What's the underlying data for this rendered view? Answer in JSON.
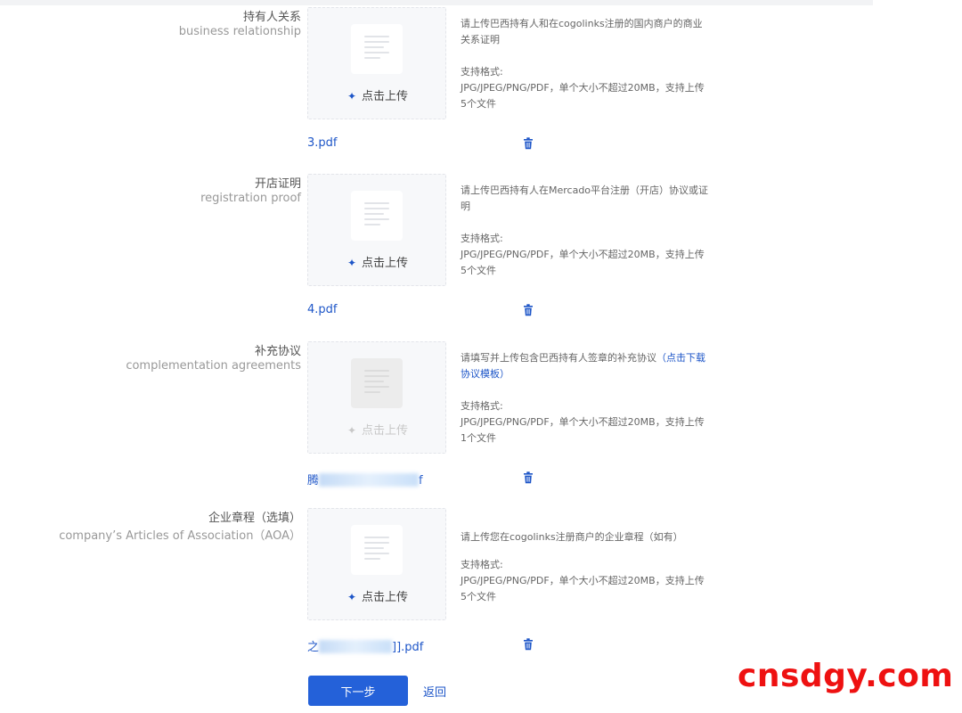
{
  "form": {
    "fields": [
      {
        "label_cn": "持有人关系",
        "label_en": "business relationship",
        "upload_label": "点击上传",
        "desc": "请上传巴西持有人和在cogolinks注册的国内商户的商业关系证明",
        "desc_link": "",
        "format_title": "支持格式:",
        "format_text": "JPG/JPEG/PNG/PDF，单个大小不超过20MB，支持上传5个文件",
        "file": {
          "prefix": "3.pdf",
          "suffix": ""
        }
      },
      {
        "label_cn": "开店证明",
        "label_en": "registration proof",
        "upload_label": "点击上传",
        "desc": "请上传巴西持有人在Mercado平台注册（开店）协议或证明",
        "desc_link": "",
        "format_title": "支持格式:",
        "format_text": "JPG/JPEG/PNG/PDF，单个大小不超过20MB，支持上传5个文件",
        "file": {
          "prefix": "4.pdf",
          "suffix": ""
        }
      },
      {
        "label_cn": "补充协议",
        "label_en": "complementation agreements",
        "upload_label": "点击上传",
        "desc": "请填写并上传包含巴西持有人签章的补充协议",
        "desc_link": "（点击下载协议模板）",
        "format_title": "支持格式:",
        "format_text": "JPG/JPEG/PNG/PDF，单个大小不超过20MB，支持上传1个文件",
        "file": {
          "prefix": "腾",
          "suffix": "f"
        }
      },
      {
        "label_cn": "企业章程（选填）",
        "label_en": "company’s Articles of Association（AOA）",
        "upload_label": "点击上传",
        "desc": "请上传您在cogolinks注册商户的企业章程（如有）",
        "desc_link": "",
        "format_title": "支持格式:",
        "format_text": "JPG/JPEG/PNG/PDF，单个大小不超过20MB，支持上传5个文件",
        "file": {
          "prefix": "之",
          "suffix": "]].pdf"
        }
      }
    ],
    "next_label": "下一步",
    "back_label": "返回"
  },
  "watermark": "cnsdgy.com",
  "colors": {
    "primary": "#2461d9",
    "link": "#1e56c8",
    "watermark": "#ee1111"
  },
  "icons": {
    "doc": "document-placeholder-icon",
    "plus": "plus-icon",
    "delete": "delete-icon"
  }
}
